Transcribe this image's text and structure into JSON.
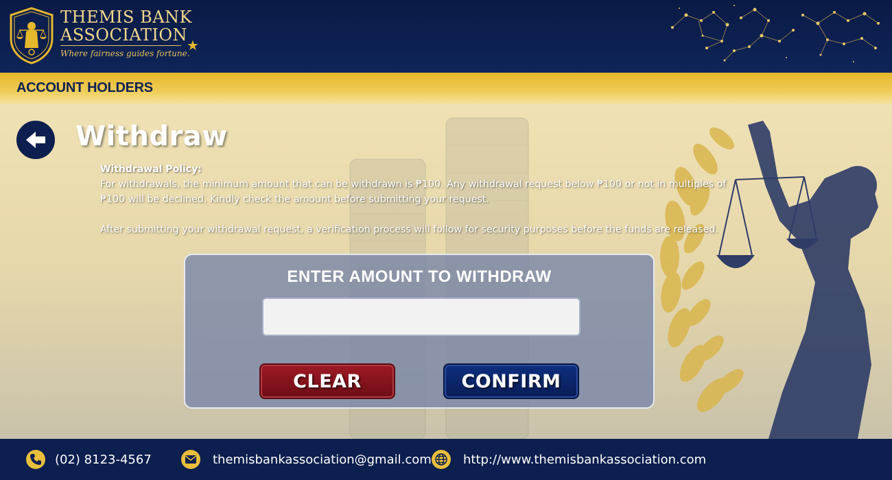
{
  "brand": {
    "name_line1": "THEMIS BANK",
    "name_line2": "ASSOCIATION",
    "tagline": "Where fairness guides fortune."
  },
  "section": {
    "title": "ACCOUNT HOLDERS"
  },
  "page": {
    "title": "Withdraw"
  },
  "policy": {
    "heading": "Withdrawal Policy:",
    "paragraph1": "For withdrawals, the minimum amount that can be withdrawn is ₱100. Any withdrawal request below ₱100 or not in multiples of ₱100 will be declined. Kindly check the amount before submitting your request.",
    "paragraph2": "After submitting your withdrawal request, a verification process will follow for security purposes before the funds are released."
  },
  "form": {
    "label": "ENTER AMOUNT TO WITHDRAW",
    "amount_value": "",
    "clear_label": "CLEAR",
    "confirm_label": "CONFIRM"
  },
  "footer": {
    "phone": "(02) 8123-4567",
    "email": "themisbankassociation@gmail.com",
    "website": "http://www.themisbankassociation.com"
  },
  "colors": {
    "navy": "#0c1f4e",
    "gold": "#e6b82b",
    "clear_red": "#8a1520",
    "confirm_blue": "#0a2568"
  },
  "icons": [
    "justice-logo-icon",
    "star-icon",
    "constellation-icon",
    "back-arrow-icon",
    "phone-icon",
    "mail-icon",
    "globe-icon"
  ]
}
